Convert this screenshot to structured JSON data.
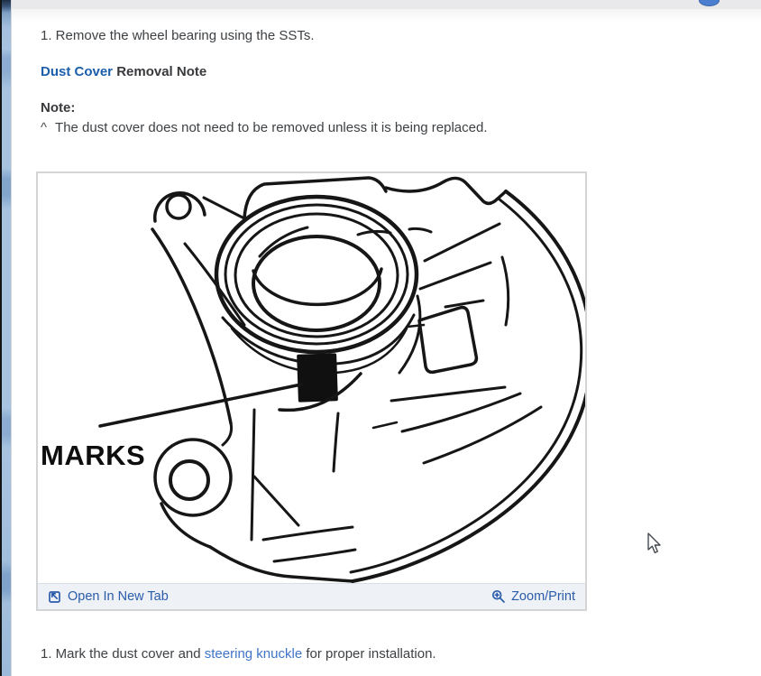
{
  "colors": {
    "accent_link": "#1b5eac",
    "light_link": "#3f74c8",
    "footer_link": "#2a5caa",
    "body_text": "#3d4144",
    "topbar_gray": "#e9e9eb",
    "left_strip_blue": "#a7c3e0",
    "figure_border": "#d4d4d4",
    "footer_bg": "#eef1f6",
    "drawing_ink": "#161616"
  },
  "content": {
    "step_remove_text": "1. Remove the wheel bearing using the SSTs.",
    "heading": {
      "link": "Dust Cover",
      "rest": " Removal Note"
    },
    "note_label": "Note:",
    "note_marker": "^",
    "note_text": "The dust cover does not need to be removed unless it is being replaced.",
    "step_mark": {
      "before": "1. Mark the dust cover and ",
      "link": "steering knuckle",
      "after": " for proper installation."
    }
  },
  "figure": {
    "drawing_label": "MARKS",
    "footer": {
      "open_in_new_tab": "Open In New Tab",
      "zoom_print": "Zoom/Print"
    },
    "icons": {
      "open_icon": "open-in-new-tab-icon",
      "zoom_icon": "magnifier-plus-icon"
    }
  },
  "cursor": {
    "type": "arrow-pointer"
  }
}
